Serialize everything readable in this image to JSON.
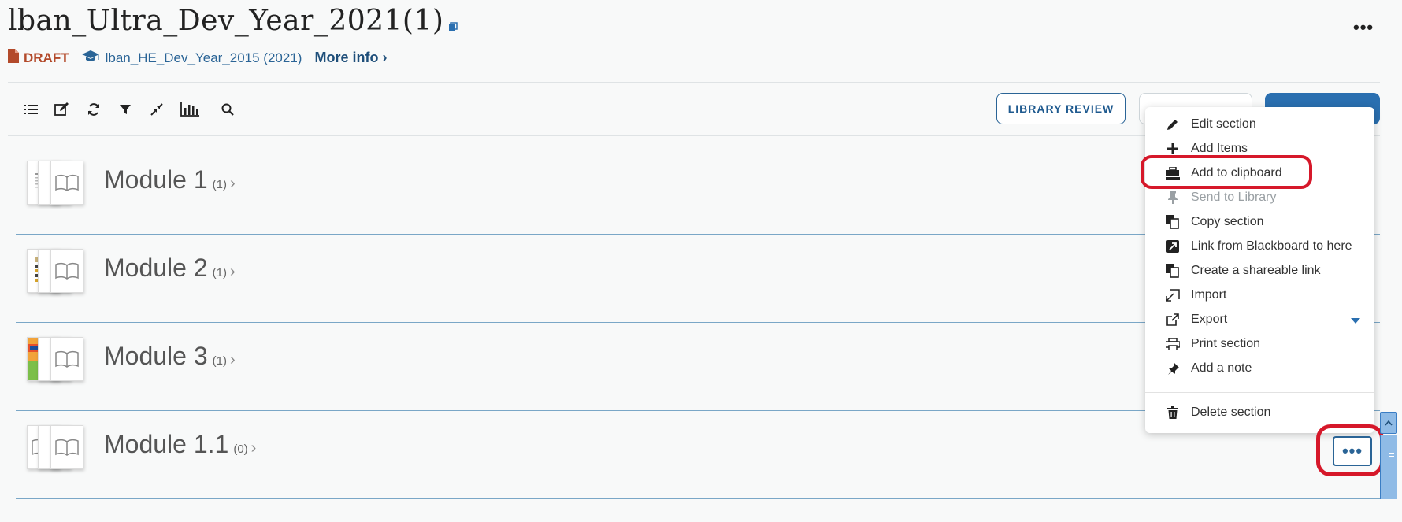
{
  "header": {
    "title": "lban_Ultra_Dev_Year_2021(1)",
    "status": "DRAFT",
    "parent_list": "lban_HE_Dev_Year_2015 (2021)",
    "more_info": "More info",
    "more_info_chevron": "›",
    "overflow": "•••"
  },
  "toolbar": {
    "icons": [
      "list-icon",
      "edit-icon",
      "refresh-icon",
      "filter-icon",
      "collapse-icon",
      "chart-icon",
      "search-icon"
    ],
    "library_review": "LIBRARY REVIEW"
  },
  "modules": [
    {
      "name": "Module 1",
      "count": "(1)"
    },
    {
      "name": "Module 2",
      "count": "(1)"
    },
    {
      "name": "Module 3",
      "count": "(1)"
    },
    {
      "name": "Module 1.1",
      "count": "(0)"
    }
  ],
  "module_chevron": "›",
  "context_menu": {
    "items": [
      {
        "label": "Edit section",
        "icon": "pencil-icon"
      },
      {
        "label": "Add Items",
        "icon": "plus-icon"
      },
      {
        "label": "Add to clipboard",
        "icon": "clipboard-icon"
      },
      {
        "label": "Send to Library",
        "icon": "pin-icon",
        "disabled": true
      },
      {
        "label": "Copy section",
        "icon": "copy-icon"
      },
      {
        "label": "Link from Blackboard to here",
        "icon": "link-icon"
      },
      {
        "label": "Create a shareable link",
        "icon": "share-icon"
      },
      {
        "label": "Import",
        "icon": "import-icon"
      },
      {
        "label": "Export",
        "icon": "external-link-icon"
      },
      {
        "label": "Print section",
        "icon": "print-icon"
      },
      {
        "label": "Add a note",
        "icon": "thumbtack-icon"
      },
      {
        "label": "Delete section",
        "icon": "trash-icon"
      }
    ]
  },
  "row_more": "•••",
  "colors": {
    "accent": "#2a6fb0",
    "draft": "#b34a2b",
    "highlight": "#d6182a"
  }
}
